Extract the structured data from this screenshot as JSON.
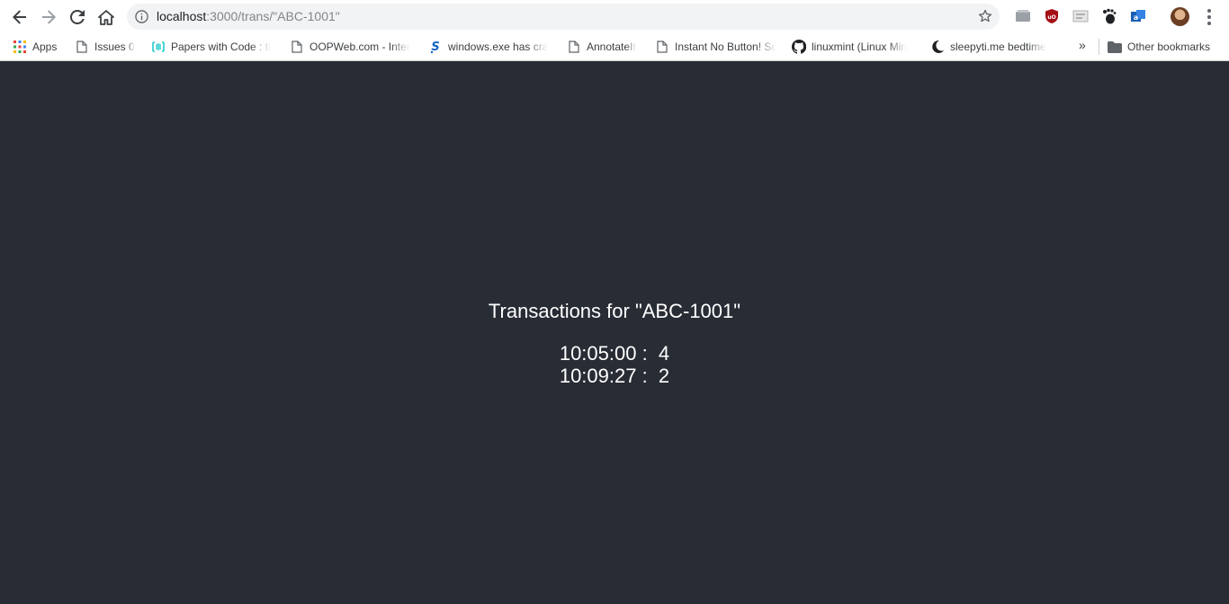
{
  "browser": {
    "url_host": "localhost",
    "url_path": ":3000/trans/\"ABC-1001\""
  },
  "bookmarks": {
    "items": [
      {
        "label": "Apps",
        "icon": "apps-grid-icon"
      },
      {
        "label": "Issues 0",
        "icon": "page-icon"
      },
      {
        "label": "Papers with Code : tl",
        "icon": "paperswithcode-icon"
      },
      {
        "label": "OOPWeb.com - Inter",
        "icon": "page-icon"
      },
      {
        "label": "windows.exe has cra",
        "icon": "s-logo-icon"
      },
      {
        "label": "AnnotateIt",
        "icon": "page-icon"
      },
      {
        "label": "Instant No Button! Sc",
        "icon": "page-icon"
      },
      {
        "label": "linuxmint (Linux Min",
        "icon": "github-icon"
      },
      {
        "label": "sleepyti.me bedtime",
        "icon": "moon-icon"
      }
    ],
    "overflow": "»",
    "other": "Other bookmarks"
  },
  "page": {
    "title": "Transactions for \"ABC-1001\"",
    "transactions": [
      {
        "time": "10:05:00",
        "count": "4"
      },
      {
        "time": "10:09:27",
        "count": "2"
      }
    ]
  }
}
